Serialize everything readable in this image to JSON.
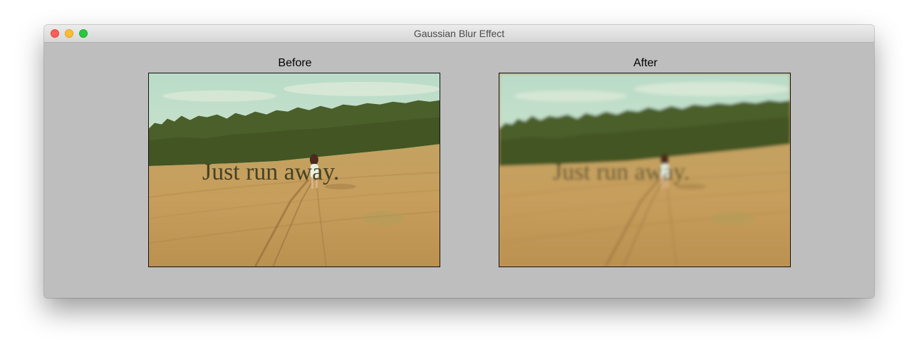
{
  "window": {
    "title": "Gaussian Blur Effect"
  },
  "panels": [
    {
      "label": "Before",
      "caption": "Just run away."
    },
    {
      "label": "After",
      "caption": "Just run away.",
      "blur_radius_applied": "gaussian"
    }
  ],
  "colors": {
    "window_background": "#bebebe",
    "close_button": "#fc5f57",
    "minimize_button": "#fdbd2e",
    "zoom_button": "#28c841",
    "sky": "#cfe5cf",
    "trees": "#445a27",
    "field": "#c89e5d",
    "caption_text": "#3b3a22"
  }
}
